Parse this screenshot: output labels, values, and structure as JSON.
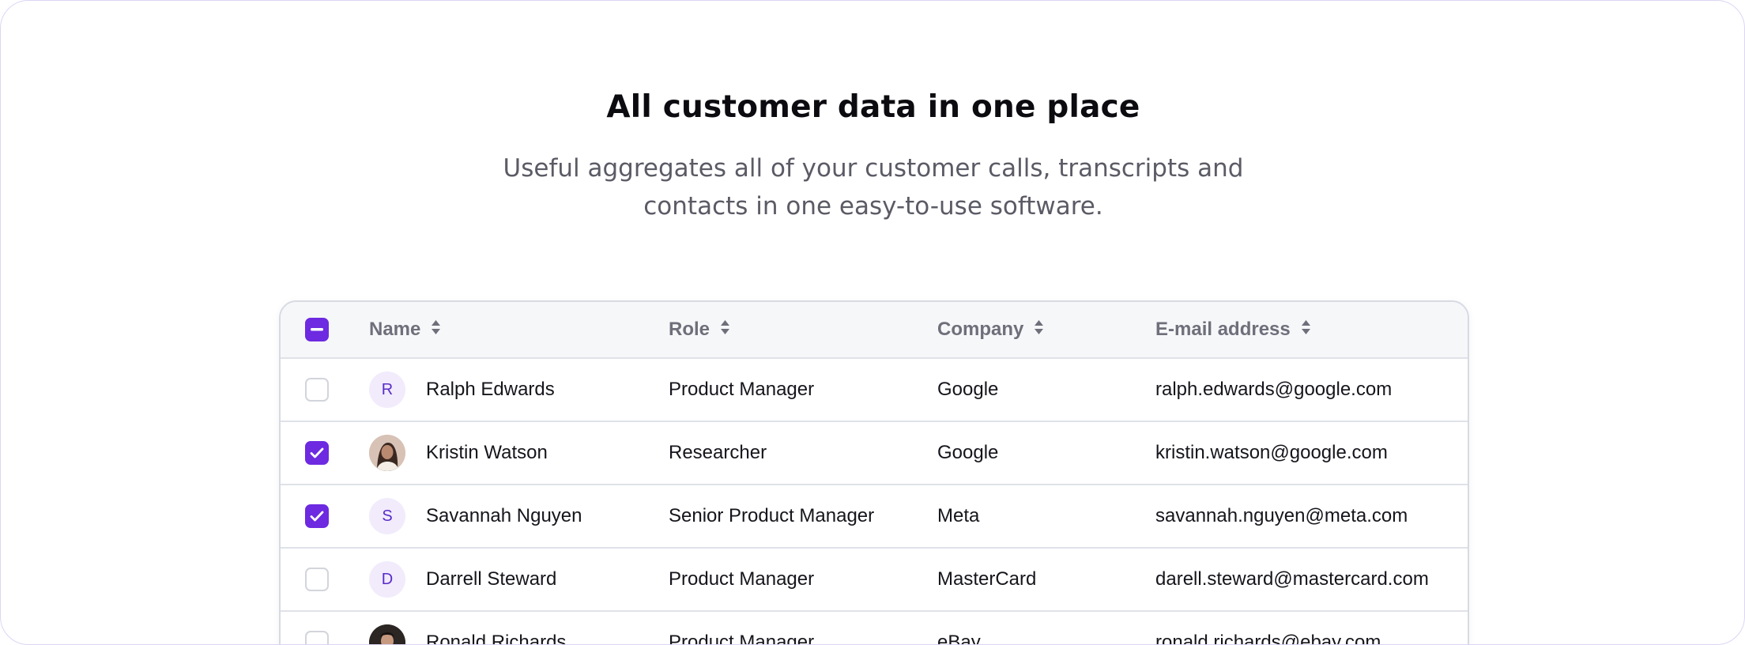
{
  "hero": {
    "title": "All customer data in one place",
    "subtitle_line1": "Useful aggregates all of your customer calls, transcripts and",
    "subtitle_line2": "contacts in one easy-to-use software."
  },
  "colors": {
    "accent": "#6d2ae0",
    "avatar_bg": "#f1ebfc",
    "border": "#d7dae3"
  },
  "table": {
    "header_checkbox_state": "indeterminate",
    "columns": [
      {
        "label": "Name",
        "sortable": true
      },
      {
        "label": "Role",
        "sortable": true
      },
      {
        "label": "Company",
        "sortable": true
      },
      {
        "label": "E-mail address",
        "sortable": true
      }
    ],
    "rows": [
      {
        "checked": false,
        "avatar_type": "initial",
        "initial": "R",
        "name": "Ralph Edwards",
        "role": "Product Manager",
        "company": "Google",
        "email": "ralph.edwards@google.com"
      },
      {
        "checked": true,
        "avatar_type": "photo",
        "initial": "",
        "name": "Kristin Watson",
        "role": "Researcher",
        "company": "Google",
        "email": "kristin.watson@google.com"
      },
      {
        "checked": true,
        "avatar_type": "initial",
        "initial": "S",
        "name": "Savannah Nguyen",
        "role": "Senior Product Manager",
        "company": "Meta",
        "email": "savannah.nguyen@meta.com"
      },
      {
        "checked": false,
        "avatar_type": "initial",
        "initial": "D",
        "name": "Darrell Steward",
        "role": "Product Manager",
        "company": "MasterCard",
        "email": "darell.steward@mastercard.com"
      },
      {
        "checked": false,
        "avatar_type": "photo",
        "initial": "",
        "name": "Ronald Richards",
        "role": "Product Manager",
        "company": "eBay",
        "email": "ronald.richards@ebay.com"
      }
    ]
  }
}
